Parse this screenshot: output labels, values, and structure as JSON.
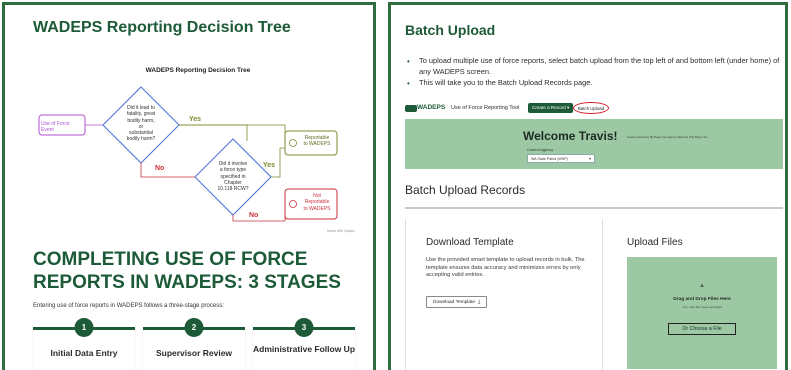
{
  "left": {
    "title": "WADEPS Reporting Decision Tree",
    "tree": {
      "title": "WADEPS Reporting Decision Tree",
      "start_box": "Use of Force Event",
      "q1": [
        "Did it lead to",
        "fatality, great",
        "bodily harm,",
        "or",
        "substantial",
        "bodily harm?"
      ],
      "q2": [
        "Did it involve",
        "a force type",
        "specified in",
        "Chapter",
        "10.118 RCW?"
      ],
      "yes_1": "Yes",
      "yes_2": "Yes",
      "no_1": "No",
      "no_2": "No",
      "reportable": [
        "Reportable",
        "to WADEPS"
      ],
      "not_reportable": [
        "Not",
        "Reportable",
        "to WADEPS"
      ],
      "credit": "Made with Napkin",
      "colors": {
        "start": "#b04fd0",
        "q": "#4a6fd8",
        "yes": "#7a8b2c",
        "no": "#c9323c"
      }
    },
    "heading": "COMPLETING USE OF FORCE REPORTS IN WADEPS: 3 STAGES",
    "intro": "Entering use of force reports in WADEPS follows a three-stage process:",
    "stages": [
      {
        "num": "1",
        "label": "Initial Data Entry"
      },
      {
        "num": "2",
        "label": "Supervisor Review"
      },
      {
        "num": "3",
        "label": "Administrative Follow Up"
      }
    ]
  },
  "right": {
    "title": "Batch Upload",
    "bullets": [
      "To upload multiple use of force reports, select batch upload from the top left of and bottom left (under home) of any WADEPS screen.",
      "This will take you to the Batch Upload Records page."
    ],
    "appbar": {
      "logo": "WADEPS",
      "app_name": "Use of Force Reporting Tool",
      "create_button": "Create a Record ▾",
      "batch_button": "Batch Upload"
    },
    "welcome": {
      "text": "Welcome Travis!",
      "links": "Create a Record  |  My Page  |  Go  Agency Records  |  My Page  |  Go",
      "agency_label": "Current Agency",
      "agency_value": "WA State Patrol (WSP)"
    },
    "batch_heading": "Batch Upload Records",
    "download": {
      "title": "Download Template",
      "description": "Use the provided smart template to upload records in bulk. The template ensures data accuracy and minimizes errors by only accepting valid entries.",
      "button": "Download Template"
    },
    "upload": {
      "title": "Upload Files",
      "drag_text": "Drag and Drop Files Here",
      "accept_text": ".csv, .xlsx files types accepted",
      "choose_button": "Or Choose a File"
    },
    "colors": {
      "brand": "#1d5a37",
      "panel_green": "#9dc8a4",
      "highlight": "#d32030"
    }
  }
}
